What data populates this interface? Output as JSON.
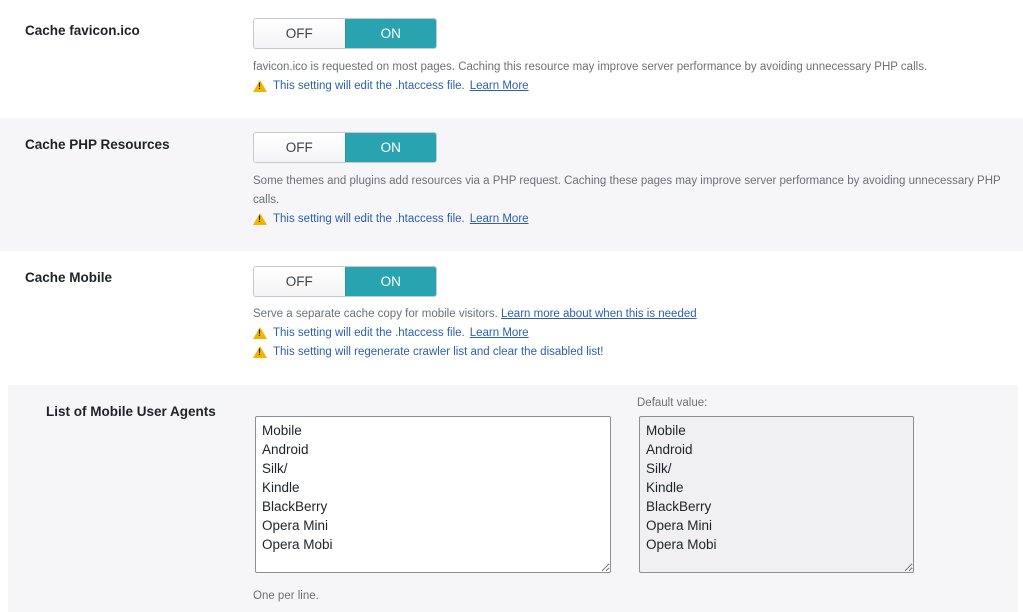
{
  "settings": [
    {
      "label": "Cache favicon.ico",
      "off_label": "OFF",
      "on_label": "ON",
      "selected": "ON",
      "description": "favicon.ico is requested on most pages. Caching this resource may improve server performance by avoiding unnecessary PHP calls.",
      "warnings": [
        {
          "text": "This setting will edit the .htaccess file.",
          "link": "Learn More"
        }
      ]
    },
    {
      "label": "Cache PHP Resources",
      "off_label": "OFF",
      "on_label": "ON",
      "selected": "ON",
      "description": "Some themes and plugins add resources via a PHP request. Caching these pages may improve server performance by avoiding unnecessary PHP calls.",
      "warnings": [
        {
          "text": "This setting will edit the .htaccess file.",
          "link": "Learn More"
        }
      ]
    },
    {
      "label": "Cache Mobile",
      "off_label": "OFF",
      "on_label": "ON",
      "selected": "ON",
      "description": "Serve a separate cache copy for mobile visitors.",
      "description_link": "Learn more about when this is needed",
      "warnings": [
        {
          "text": "This setting will edit the .htaccess file.",
          "link": "Learn More"
        },
        {
          "text": "This setting will regenerate crawler list and clear the disabled list!",
          "link": ""
        }
      ]
    }
  ],
  "mobile_user_agents": {
    "label": "List of Mobile User Agents",
    "value": "Mobile\nAndroid\nSilk/\nKindle\nBlackBerry\nOpera Mini\nOpera Mobi",
    "default_label": "Default value:",
    "default_value": "Mobile\nAndroid\nSilk/\nKindle\nBlackBerry\nOpera Mini\nOpera Mobi",
    "hint": "One per line."
  },
  "colors": {
    "accent": "#2aa3b1",
    "warning_icon": "#f2b400",
    "link": "#2b5fb0"
  },
  "icons": {
    "warning": "warning-triangle-icon"
  }
}
